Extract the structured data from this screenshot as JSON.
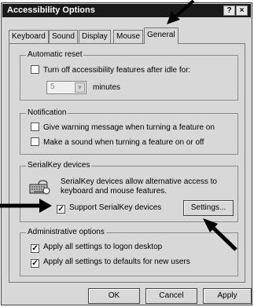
{
  "window": {
    "title": "Accessibility Options",
    "help_button": "?",
    "close_button": "×"
  },
  "tabs": [
    {
      "label": "Keyboard"
    },
    {
      "label": "Sound"
    },
    {
      "label": "Display"
    },
    {
      "label": "Mouse"
    },
    {
      "label": "General",
      "active": true
    }
  ],
  "automatic_reset": {
    "title": "Automatic reset",
    "checkbox_label": "Turn off accessibility features after idle for:",
    "checked": false,
    "minutes_value": "5",
    "minutes_label": "minutes"
  },
  "notification": {
    "title": "Notification",
    "items": [
      {
        "label": "Give warning message when turning a feature on",
        "checked": false
      },
      {
        "label": "Make a sound when turning a feature on or off",
        "checked": false
      }
    ]
  },
  "serialkey": {
    "title": "SerialKey devices",
    "description_line1": "SerialKey devices allow alternative access to",
    "description_line2": "keyboard and mouse features.",
    "checkbox_label": "Support SerialKey devices",
    "checked": true,
    "settings_button": "Settings..."
  },
  "administrative": {
    "title": "Administrative options",
    "items": [
      {
        "label": "Apply all settings to logon desktop",
        "checked": true
      },
      {
        "label": "Apply all settings to defaults for new users",
        "checked": true
      }
    ]
  },
  "footer": {
    "ok": "OK",
    "cancel": "Cancel",
    "apply": "Apply"
  },
  "check_mark": "✓"
}
